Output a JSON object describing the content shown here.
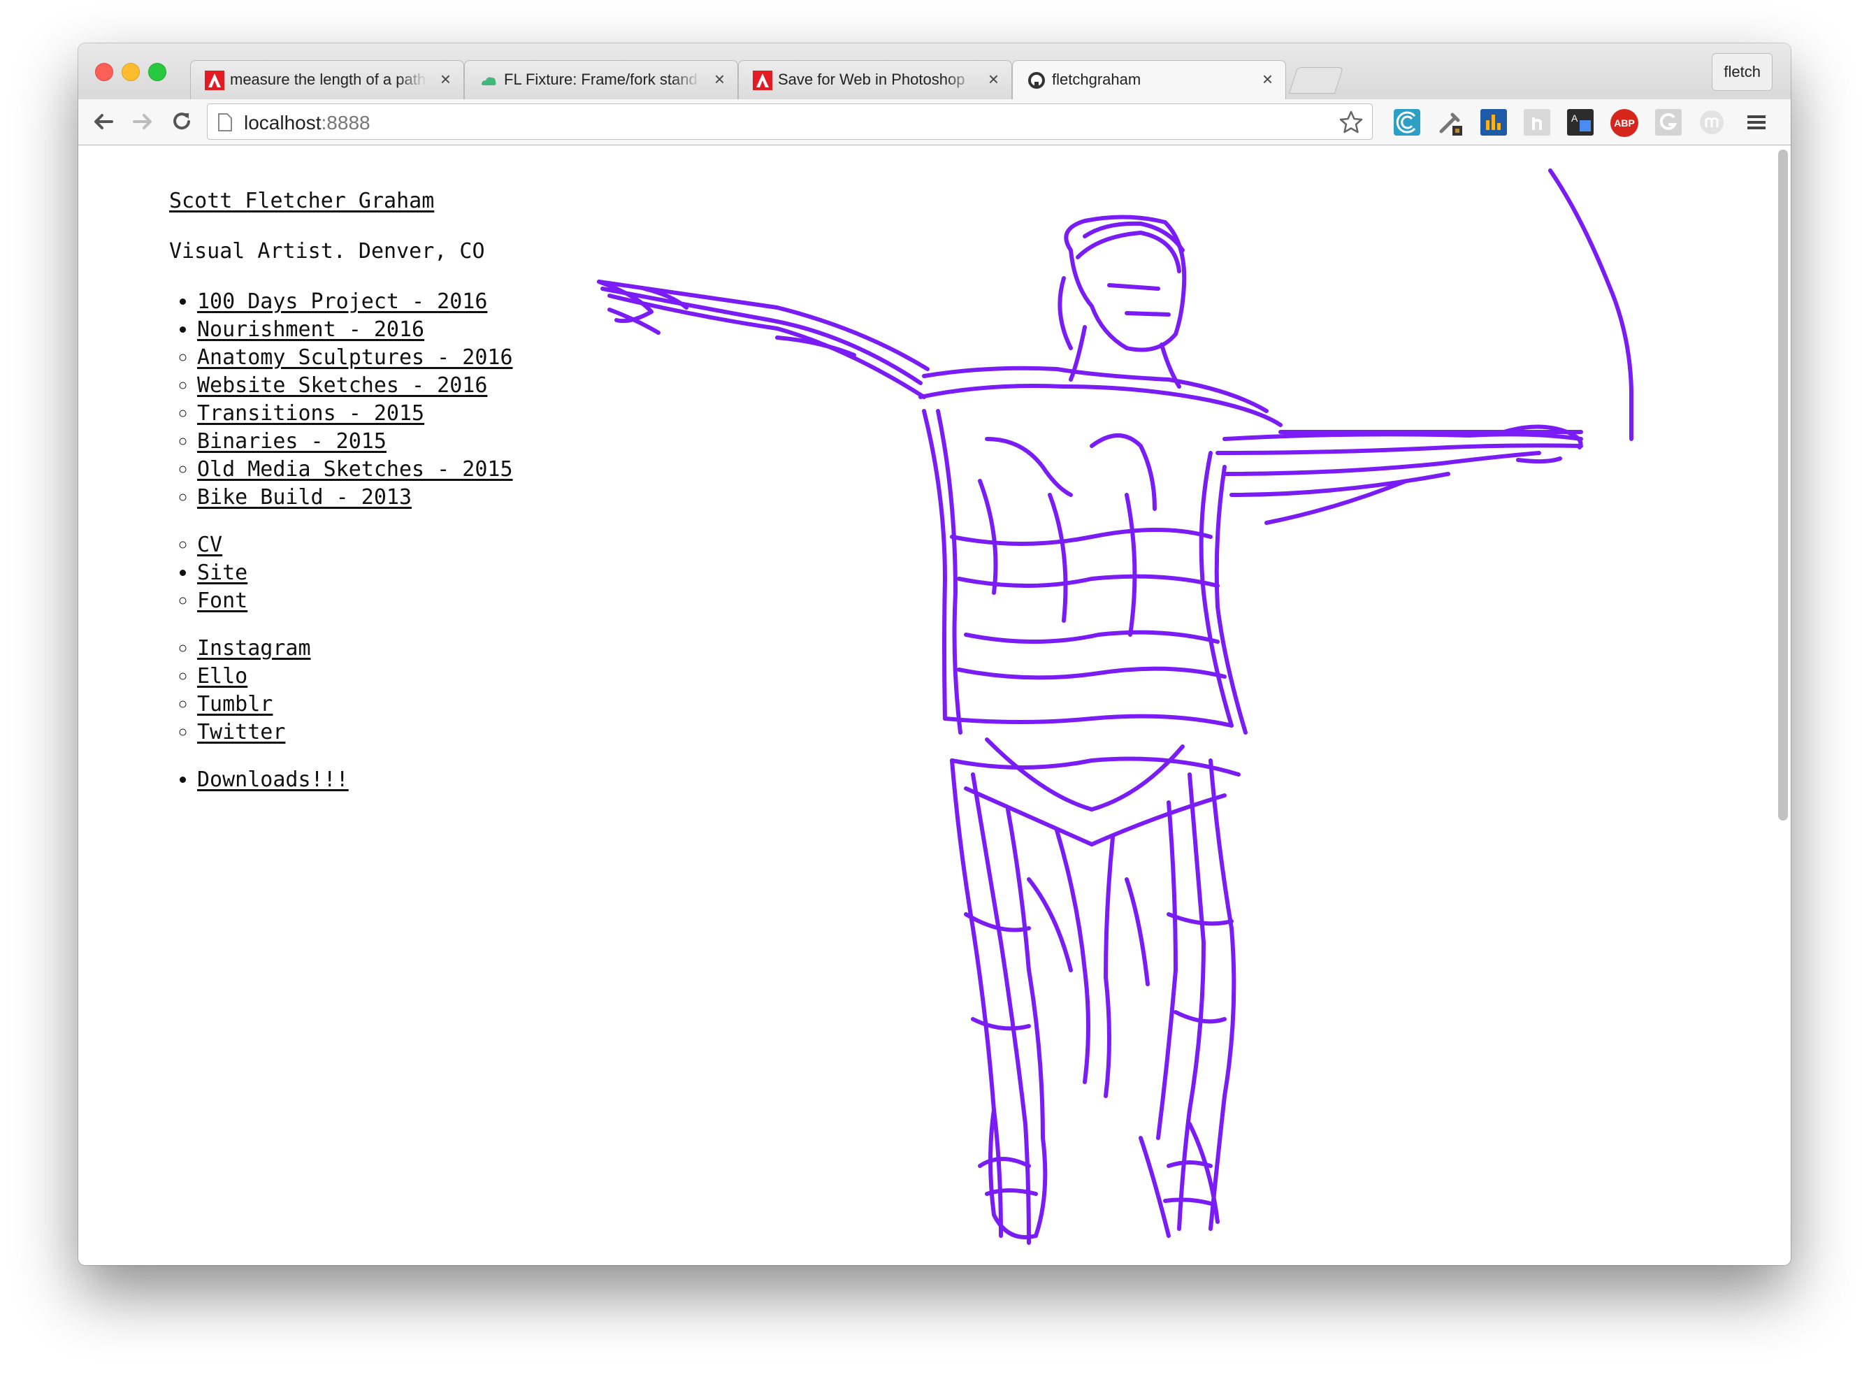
{
  "browser": {
    "tabs": [
      {
        "title": "measure the length of a path",
        "favicon": "adobe-icon",
        "active": false
      },
      {
        "title": "FL Fixture: Frame/fork stand",
        "favicon": "cloud-icon",
        "active": false
      },
      {
        "title": "Save for Web in Photoshop",
        "favicon": "adobe-icon",
        "active": false
      },
      {
        "title": "fletchgraham",
        "favicon": "github-icon",
        "active": true
      }
    ],
    "profile_name": "fletch",
    "url_host": "localhost",
    "url_port": ":8888",
    "extensions": [
      "wave-icon",
      "eyedropper-icon",
      "chart-icon",
      "hand-icon",
      "translate-icon",
      "adblock-icon",
      "grammarly-icon",
      "m-icon"
    ],
    "adblock_label": "ABP"
  },
  "site": {
    "name": "Scott Fletcher Graham",
    "subtitle": "Visual Artist. Denver, CO",
    "projects": [
      {
        "label": "100 Days Project - 2016",
        "bullet": "disc"
      },
      {
        "label": "Nourishment - 2016",
        "bullet": "disc"
      },
      {
        "label": "Anatomy Sculptures - 2016",
        "bullet": "circle"
      },
      {
        "label": "Website Sketches - 2016",
        "bullet": "circle"
      },
      {
        "label": "Transitions - 2015",
        "bullet": "circle"
      },
      {
        "label": "Binaries - 2015",
        "bullet": "circle"
      },
      {
        "label": "Old Media Sketches - 2015",
        "bullet": "circle"
      },
      {
        "label": "Bike Build - 2013",
        "bullet": "circle"
      }
    ],
    "info_links": [
      {
        "label": "CV",
        "bullet": "circle"
      },
      {
        "label": "Site",
        "bullet": "disc"
      },
      {
        "label": "Font",
        "bullet": "circle"
      }
    ],
    "social_links": [
      {
        "label": "Instagram",
        "bullet": "circle"
      },
      {
        "label": "Ello",
        "bullet": "circle"
      },
      {
        "label": "Tumblr",
        "bullet": "circle"
      },
      {
        "label": "Twitter",
        "bullet": "circle"
      }
    ],
    "downloads": {
      "label": "Downloads!!!",
      "bullet": "disc"
    },
    "sketch_color": "#7a1cf5"
  }
}
